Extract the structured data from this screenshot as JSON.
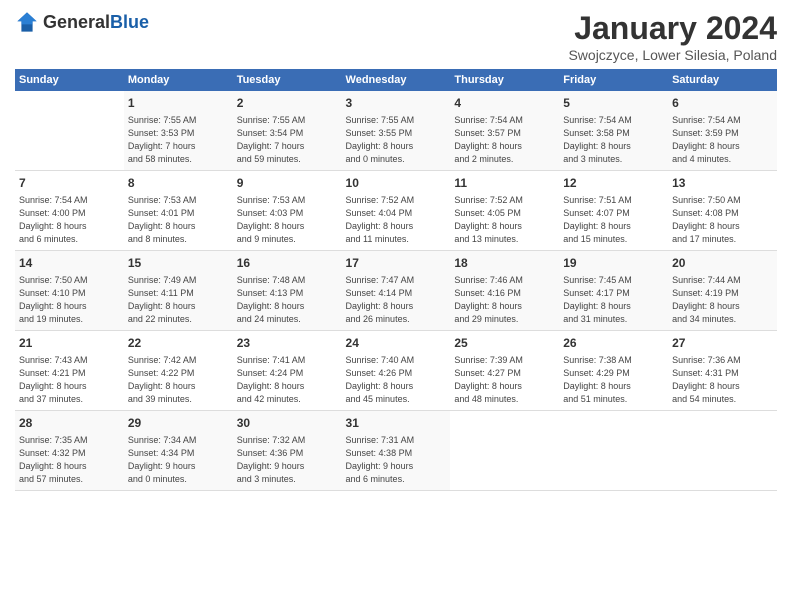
{
  "header": {
    "logo_general": "General",
    "logo_blue": "Blue",
    "title": "January 2024",
    "subtitle": "Swojczyce, Lower Silesia, Poland"
  },
  "days_of_week": [
    "Sunday",
    "Monday",
    "Tuesday",
    "Wednesday",
    "Thursday",
    "Friday",
    "Saturday"
  ],
  "weeks": [
    [
      {
        "day": "",
        "info": ""
      },
      {
        "day": "1",
        "info": "Sunrise: 7:55 AM\nSunset: 3:53 PM\nDaylight: 7 hours\nand 58 minutes."
      },
      {
        "day": "2",
        "info": "Sunrise: 7:55 AM\nSunset: 3:54 PM\nDaylight: 7 hours\nand 59 minutes."
      },
      {
        "day": "3",
        "info": "Sunrise: 7:55 AM\nSunset: 3:55 PM\nDaylight: 8 hours\nand 0 minutes."
      },
      {
        "day": "4",
        "info": "Sunrise: 7:54 AM\nSunset: 3:57 PM\nDaylight: 8 hours\nand 2 minutes."
      },
      {
        "day": "5",
        "info": "Sunrise: 7:54 AM\nSunset: 3:58 PM\nDaylight: 8 hours\nand 3 minutes."
      },
      {
        "day": "6",
        "info": "Sunrise: 7:54 AM\nSunset: 3:59 PM\nDaylight: 8 hours\nand 4 minutes."
      }
    ],
    [
      {
        "day": "7",
        "info": "Sunrise: 7:54 AM\nSunset: 4:00 PM\nDaylight: 8 hours\nand 6 minutes."
      },
      {
        "day": "8",
        "info": "Sunrise: 7:53 AM\nSunset: 4:01 PM\nDaylight: 8 hours\nand 8 minutes."
      },
      {
        "day": "9",
        "info": "Sunrise: 7:53 AM\nSunset: 4:03 PM\nDaylight: 8 hours\nand 9 minutes."
      },
      {
        "day": "10",
        "info": "Sunrise: 7:52 AM\nSunset: 4:04 PM\nDaylight: 8 hours\nand 11 minutes."
      },
      {
        "day": "11",
        "info": "Sunrise: 7:52 AM\nSunset: 4:05 PM\nDaylight: 8 hours\nand 13 minutes."
      },
      {
        "day": "12",
        "info": "Sunrise: 7:51 AM\nSunset: 4:07 PM\nDaylight: 8 hours\nand 15 minutes."
      },
      {
        "day": "13",
        "info": "Sunrise: 7:50 AM\nSunset: 4:08 PM\nDaylight: 8 hours\nand 17 minutes."
      }
    ],
    [
      {
        "day": "14",
        "info": "Sunrise: 7:50 AM\nSunset: 4:10 PM\nDaylight: 8 hours\nand 19 minutes."
      },
      {
        "day": "15",
        "info": "Sunrise: 7:49 AM\nSunset: 4:11 PM\nDaylight: 8 hours\nand 22 minutes."
      },
      {
        "day": "16",
        "info": "Sunrise: 7:48 AM\nSunset: 4:13 PM\nDaylight: 8 hours\nand 24 minutes."
      },
      {
        "day": "17",
        "info": "Sunrise: 7:47 AM\nSunset: 4:14 PM\nDaylight: 8 hours\nand 26 minutes."
      },
      {
        "day": "18",
        "info": "Sunrise: 7:46 AM\nSunset: 4:16 PM\nDaylight: 8 hours\nand 29 minutes."
      },
      {
        "day": "19",
        "info": "Sunrise: 7:45 AM\nSunset: 4:17 PM\nDaylight: 8 hours\nand 31 minutes."
      },
      {
        "day": "20",
        "info": "Sunrise: 7:44 AM\nSunset: 4:19 PM\nDaylight: 8 hours\nand 34 minutes."
      }
    ],
    [
      {
        "day": "21",
        "info": "Sunrise: 7:43 AM\nSunset: 4:21 PM\nDaylight: 8 hours\nand 37 minutes."
      },
      {
        "day": "22",
        "info": "Sunrise: 7:42 AM\nSunset: 4:22 PM\nDaylight: 8 hours\nand 39 minutes."
      },
      {
        "day": "23",
        "info": "Sunrise: 7:41 AM\nSunset: 4:24 PM\nDaylight: 8 hours\nand 42 minutes."
      },
      {
        "day": "24",
        "info": "Sunrise: 7:40 AM\nSunset: 4:26 PM\nDaylight: 8 hours\nand 45 minutes."
      },
      {
        "day": "25",
        "info": "Sunrise: 7:39 AM\nSunset: 4:27 PM\nDaylight: 8 hours\nand 48 minutes."
      },
      {
        "day": "26",
        "info": "Sunrise: 7:38 AM\nSunset: 4:29 PM\nDaylight: 8 hours\nand 51 minutes."
      },
      {
        "day": "27",
        "info": "Sunrise: 7:36 AM\nSunset: 4:31 PM\nDaylight: 8 hours\nand 54 minutes."
      }
    ],
    [
      {
        "day": "28",
        "info": "Sunrise: 7:35 AM\nSunset: 4:32 PM\nDaylight: 8 hours\nand 57 minutes."
      },
      {
        "day": "29",
        "info": "Sunrise: 7:34 AM\nSunset: 4:34 PM\nDaylight: 9 hours\nand 0 minutes."
      },
      {
        "day": "30",
        "info": "Sunrise: 7:32 AM\nSunset: 4:36 PM\nDaylight: 9 hours\nand 3 minutes."
      },
      {
        "day": "31",
        "info": "Sunrise: 7:31 AM\nSunset: 4:38 PM\nDaylight: 9 hours\nand 6 minutes."
      },
      {
        "day": "",
        "info": ""
      },
      {
        "day": "",
        "info": ""
      },
      {
        "day": "",
        "info": ""
      }
    ]
  ]
}
